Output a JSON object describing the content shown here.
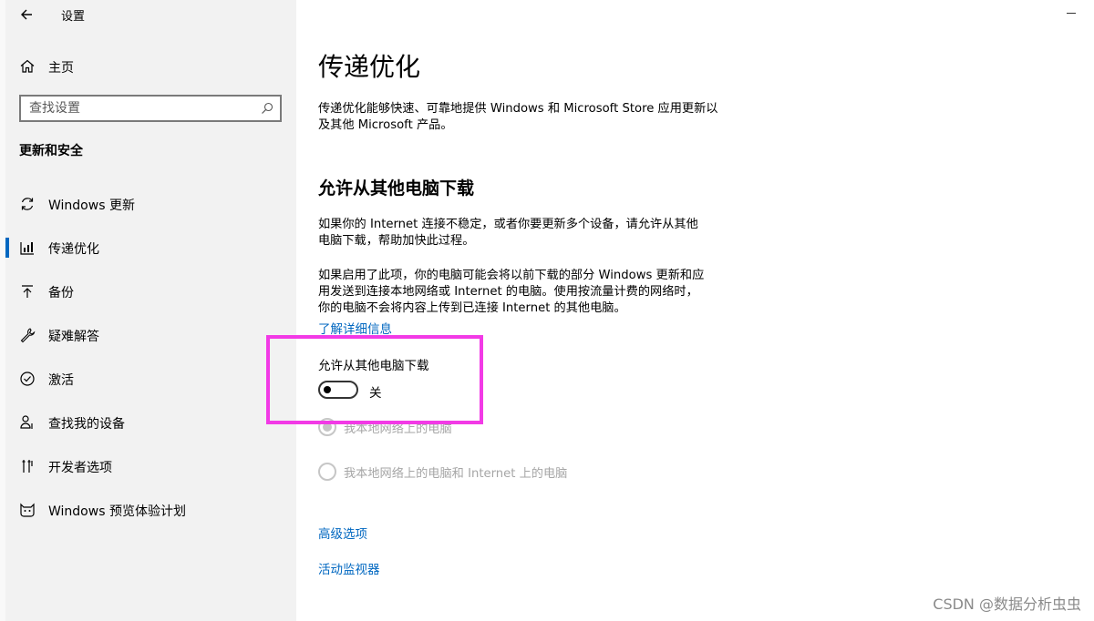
{
  "window": {
    "title": "设置"
  },
  "sidebar": {
    "home_label": "主页",
    "search_placeholder": "查找设置",
    "section_heading": "更新和安全",
    "items": [
      {
        "label": "Windows 更新",
        "icon": "refresh-icon"
      },
      {
        "label": "传递优化",
        "icon": "delivery-optimization-icon",
        "selected": true
      },
      {
        "label": "备份",
        "icon": "backup-arrow-icon"
      },
      {
        "label": "疑难解答",
        "icon": "wrench-icon"
      },
      {
        "label": "激活",
        "icon": "checkmark-circle-icon"
      },
      {
        "label": "查找我的设备",
        "icon": "person-location-icon"
      },
      {
        "label": "开发者选项",
        "icon": "developer-tools-icon"
      },
      {
        "label": "Windows 预览体验计划",
        "icon": "insider-cat-icon"
      }
    ]
  },
  "main": {
    "title": "传递优化",
    "intro": [
      "传递优化能够快速、可靠地提供 Windows 和 Microsoft Store 应用更新以",
      "及其他 Microsoft 产品。"
    ],
    "subheading": "允许从其他电脑下载",
    "para1": [
      "如果你的 Internet 连接不稳定，或者你要更新多个设备，请允许从其他",
      "电脑下载，帮助加快此过程。"
    ],
    "para2": [
      "如果启用了此项，你的电脑可能会将以前下载的部分 Windows 更新和应",
      "用发送到连接本地网络或 Internet 的电脑。使用按流量计费的网络时，",
      "你的电脑不会将内容上传到已连接 Internet 的其他电脑。"
    ],
    "learn_more": "了解详细信息",
    "toggle": {
      "label": "允许从其他电脑下载",
      "state_text": "关",
      "on": false
    },
    "radio_options": [
      {
        "label": "我本地网络上的电脑",
        "selected": true,
        "disabled": true
      },
      {
        "label": "我本地网络上的电脑和 Internet 上的电脑",
        "selected": false,
        "disabled": true
      }
    ],
    "links": {
      "advanced": "高级选项",
      "activity_monitor": "活动监视器"
    }
  },
  "watermark": "CSDN @数据分析虫虫",
  "colors": {
    "accent": "#0067c0",
    "highlight": "#f23ae6",
    "sidebar_bg": "#f2f2f2"
  }
}
